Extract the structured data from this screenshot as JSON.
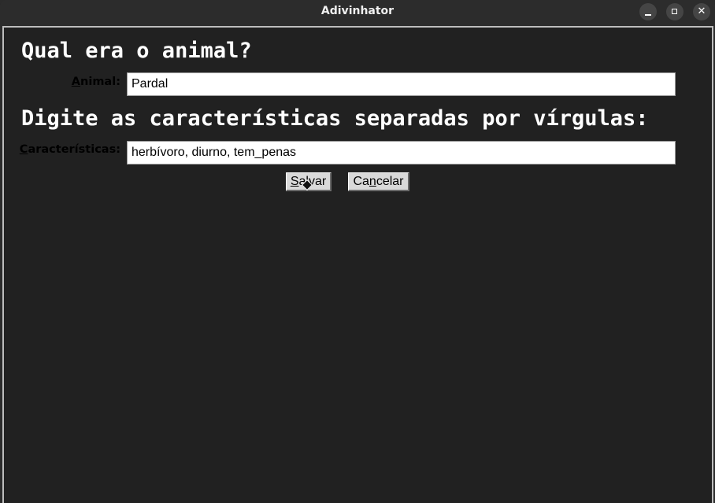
{
  "window": {
    "title": "Adivinhator",
    "controls": {
      "minimize": "minimize-icon",
      "maximize": "maximize-icon",
      "close": "close-icon"
    }
  },
  "form": {
    "heading_animal": "Qual era o animal?",
    "animal_label_mnemonic": "A",
    "animal_label_rest": "nimal:",
    "animal_value": "Pardal",
    "heading_traits": "Digite as características separadas por vírgulas:",
    "traits_label_mnemonic": "C",
    "traits_label_rest": "aracterísticas:",
    "traits_value": "herbívoro, diurno, tem_penas"
  },
  "buttons": {
    "save_mnemonic": "S",
    "save_rest": "alvar",
    "cancel_prefix": "Ca",
    "cancel_mnemonic": "n",
    "cancel_rest": "celar"
  },
  "colors": {
    "background": "#212121",
    "titlebar": "#2c2c2c",
    "input_background": "#ffffff",
    "button_background": "#d9d9d9"
  }
}
